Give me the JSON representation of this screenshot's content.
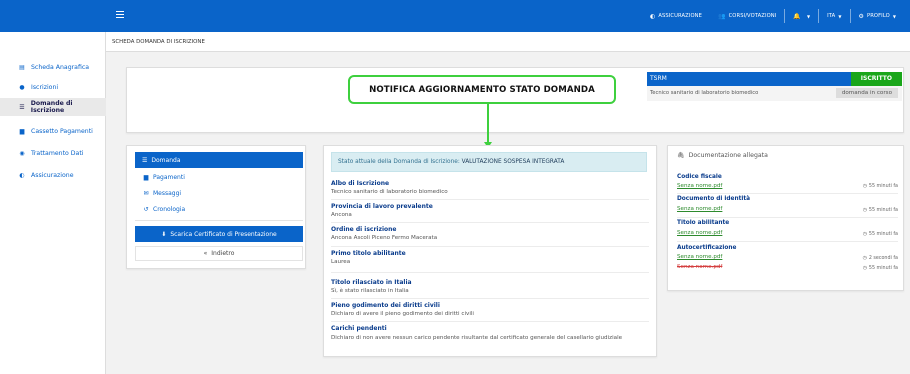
{
  "topbar": {
    "menu_icon": "hamburger-icon",
    "brand_color": "#0a64c9",
    "nav": {
      "assicurazione": "ASSICURAZIONE",
      "corsi": "CORSI/VOTAZIONI",
      "language": "ITA",
      "profile": "PROFILO"
    }
  },
  "sidebar": {
    "items": [
      {
        "label": "Scheda Anagrafica",
        "icon": "id-card-icon"
      },
      {
        "label": "Iscrizioni",
        "icon": "user-icon"
      },
      {
        "label": "Domande di Iscrizione",
        "icon": "list-icon",
        "active": true
      },
      {
        "label": "Cassetto Pagamenti",
        "icon": "file-icon"
      },
      {
        "label": "Trattamento Dati",
        "icon": "eye-icon"
      },
      {
        "label": "Assicurazione",
        "icon": "shield-icon"
      }
    ]
  },
  "breadcrumb": "SCHEDA DOMANDA DI ISCRIZIONE",
  "notification": "NOTIFICA AGGIORNAMENTO STATO DOMANDA",
  "profession": {
    "code": "TSRM",
    "badge": "ISCRITTO",
    "badge_color": "#1aa61a",
    "name": "Tecnico sanitario di laboratorio biomedico",
    "status": "domanda in corso"
  },
  "menu": {
    "active": "Domanda",
    "links": [
      "Pagamenti",
      "Messaggi",
      "Cronologia"
    ],
    "certificate": "Scarica Certificato di Presentazione",
    "back": "Indietro"
  },
  "status_banner": {
    "prefix": "Stato attuale della Domanda di Iscrizione:",
    "value": "VALUTAZIONE SOSPESA INTEGRATA"
  },
  "fields": [
    {
      "label": "Albo di Iscrizione",
      "value": "Tecnico sanitario di laboratorio biomedico"
    },
    {
      "label": "Provincia di lavoro prevalente",
      "value": "Ancona"
    },
    {
      "label": "Ordine di iscrizione",
      "value": "Ancona Ascoli Piceno Fermo Macerata"
    },
    {
      "label": "Primo titolo abilitante",
      "value": "Laurea"
    },
    {
      "label": "Titolo rilasciato in Italia",
      "value": "Sì, è stato rilasciato in Italia"
    },
    {
      "label": "Pieno godimento dei diritti civili",
      "value": "Dichiaro di avere il pieno godimento dei diritti civili"
    },
    {
      "label": "Carichi pendenti",
      "value": "Dichiaro di non avere nessun carico pendente risultante dal certificato generale del casellario giudiziale"
    }
  ],
  "documents": {
    "title": "Documentazione allegata",
    "groups": [
      {
        "category": "Codice fiscale",
        "files": [
          {
            "name": "Senza nome.pdf",
            "time": "55 minuti fa"
          }
        ]
      },
      {
        "category": "Documento di identità",
        "files": [
          {
            "name": "Senza nome.pdf",
            "time": "55 minuti fa"
          }
        ]
      },
      {
        "category": "Titolo abilitante",
        "files": [
          {
            "name": "Senza nome.pdf",
            "time": "55 minuti fa"
          }
        ]
      },
      {
        "category": "Autocertificazione",
        "files": [
          {
            "name": "Senza nome.pdf",
            "time": "2 secondi fa"
          },
          {
            "name": "Senza nome.pdf",
            "time": "55 minuti fa",
            "removed": true
          }
        ]
      }
    ]
  }
}
